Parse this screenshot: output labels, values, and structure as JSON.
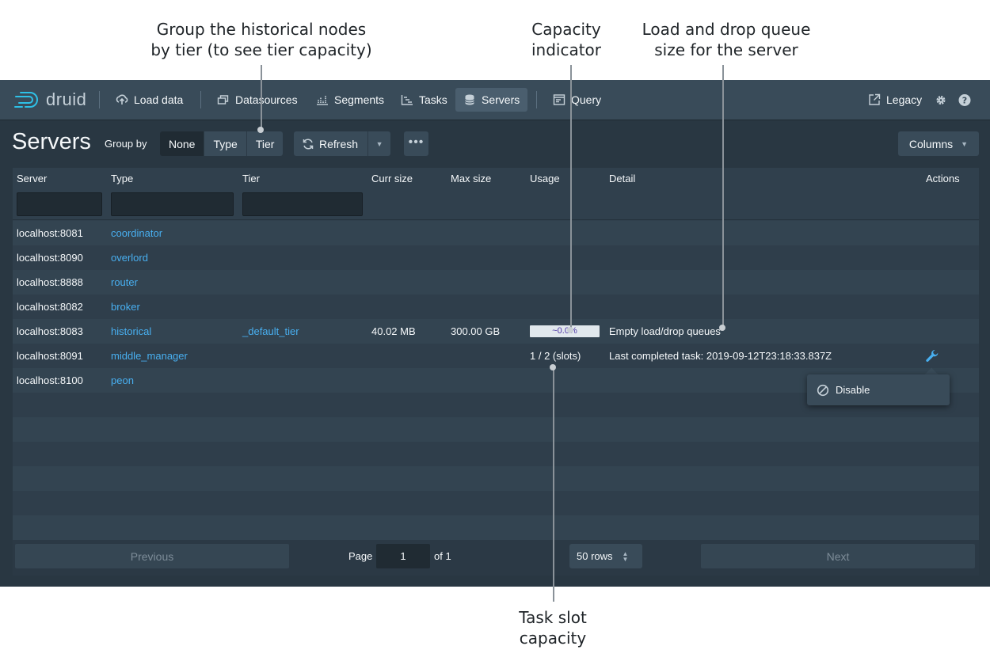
{
  "callouts": {
    "group_line1": "Group the historical nodes",
    "group_line2": "by tier (to see tier capacity)",
    "capacity_line1": "Capacity",
    "capacity_line2": "indicator",
    "queue_line1": "Load and drop queue",
    "queue_line2": "size for the server",
    "slot_line1": "Task slot",
    "slot_line2": "capacity"
  },
  "nav": {
    "logo": "druid",
    "load_data": "Load data",
    "datasources": "Datasources",
    "segments": "Segments",
    "tasks": "Tasks",
    "servers": "Servers",
    "query": "Query",
    "legacy": "Legacy"
  },
  "toolbar": {
    "title": "Servers",
    "group_by_label": "Group by",
    "group_none": "None",
    "group_type": "Type",
    "group_tier": "Tier",
    "refresh": "Refresh",
    "columns": "Columns"
  },
  "table": {
    "headers": {
      "server": "Server",
      "type": "Type",
      "tier": "Tier",
      "curr_size": "Curr size",
      "max_size": "Max size",
      "usage": "Usage",
      "detail": "Detail",
      "actions": "Actions"
    },
    "rows": [
      {
        "server": "localhost:8081",
        "type": "coordinator"
      },
      {
        "server": "localhost:8090",
        "type": "overlord"
      },
      {
        "server": "localhost:8888",
        "type": "router"
      },
      {
        "server": "localhost:8082",
        "type": "broker"
      },
      {
        "server": "localhost:8083",
        "type": "historical",
        "tier": "_default_tier",
        "curr_size": "40.02 MB",
        "max_size": "300.00 GB",
        "usage": "~0.0%",
        "detail": "Empty load/drop queues"
      },
      {
        "server": "localhost:8091",
        "type": "middle_manager",
        "usage": "1 / 2 (slots)",
        "detail": "Last completed task: 2019-09-12T23:18:33.837Z"
      },
      {
        "server": "localhost:8100",
        "type": "peon"
      }
    ]
  },
  "action_menu": {
    "disable": "Disable"
  },
  "pagination": {
    "previous": "Previous",
    "page_label": "Page",
    "page_value": "1",
    "of_label": "of 1",
    "rows_select": "50 rows",
    "next": "Next"
  },
  "colors": {
    "app_bg": "#293742",
    "navbar_bg": "#394b59",
    "link": "#48aff0",
    "text": "#f5f8fa"
  }
}
